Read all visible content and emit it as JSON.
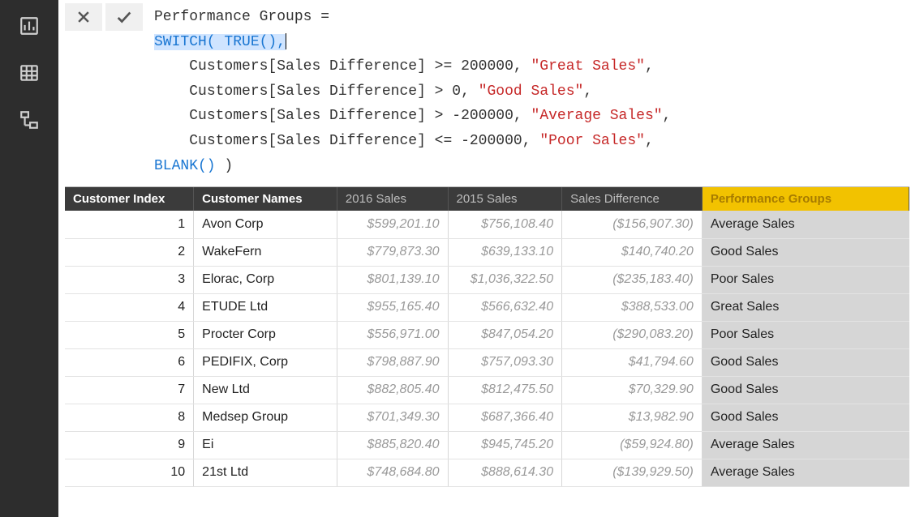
{
  "rail": {
    "icons": [
      "report-icon",
      "data-icon",
      "model-icon"
    ]
  },
  "formula": {
    "measure_name": "Performance Groups",
    "equals": " =",
    "line2_kw": "SWITCH(",
    "line2_true": " TRUE()",
    "line2_comma": ",",
    "line3_expr": "Customers[Sales Difference] >= ",
    "line3_val": "200000",
    "line3_rest": ", ",
    "line3_str": "\"Great Sales\"",
    "line3_end": ",",
    "line4_expr": "Customers[Sales Difference] > ",
    "line4_val": "0",
    "line4_rest": ", ",
    "line4_str": "\"Good Sales\"",
    "line4_end": ",",
    "line5_expr": "Customers[Sales Difference] > ",
    "line5_val": "-200000",
    "line5_rest": ", ",
    "line5_str": "\"Average Sales\"",
    "line5_end": ",",
    "line6_expr": "Customers[Sales Difference] <= ",
    "line6_val": "-200000",
    "line6_rest": ", ",
    "line6_str": "\"Poor Sales\"",
    "line6_end": ",",
    "line7_kw": "BLANK()",
    "line7_end": " )"
  },
  "columns": {
    "idx": "Customer Index",
    "name": "Customer Names",
    "y16": "2016 Sales",
    "y15": "2015 Sales",
    "diff": "Sales Difference",
    "perf": "Performance Groups"
  },
  "rows": [
    {
      "idx": "1",
      "name": "Avon Corp",
      "y16": "$599,201.10",
      "y15": "$756,108.40",
      "diff": "($156,907.30)",
      "perf": "Average Sales"
    },
    {
      "idx": "2",
      "name": "WakeFern",
      "y16": "$779,873.30",
      "y15": "$639,133.10",
      "diff": "$140,740.20",
      "perf": "Good Sales"
    },
    {
      "idx": "3",
      "name": "Elorac, Corp",
      "y16": "$801,139.10",
      "y15": "$1,036,322.50",
      "diff": "($235,183.40)",
      "perf": "Poor Sales"
    },
    {
      "idx": "4",
      "name": "ETUDE Ltd",
      "y16": "$955,165.40",
      "y15": "$566,632.40",
      "diff": "$388,533.00",
      "perf": "Great Sales"
    },
    {
      "idx": "5",
      "name": "Procter Corp",
      "y16": "$556,971.00",
      "y15": "$847,054.20",
      "diff": "($290,083.20)",
      "perf": "Poor Sales"
    },
    {
      "idx": "6",
      "name": "PEDIFIX, Corp",
      "y16": "$798,887.90",
      "y15": "$757,093.30",
      "diff": "$41,794.60",
      "perf": "Good Sales"
    },
    {
      "idx": "7",
      "name": "New Ltd",
      "y16": "$882,805.40",
      "y15": "$812,475.50",
      "diff": "$70,329.90",
      "perf": "Good Sales"
    },
    {
      "idx": "8",
      "name": "Medsep Group",
      "y16": "$701,349.30",
      "y15": "$687,366.40",
      "diff": "$13,982.90",
      "perf": "Good Sales"
    },
    {
      "idx": "9",
      "name": "Ei",
      "y16": "$885,820.40",
      "y15": "$945,745.20",
      "diff": "($59,924.80)",
      "perf": "Average Sales"
    },
    {
      "idx": "10",
      "name": "21st Ltd",
      "y16": "$748,684.80",
      "y15": "$888,614.30",
      "diff": "($139,929.50)",
      "perf": "Average Sales"
    }
  ]
}
